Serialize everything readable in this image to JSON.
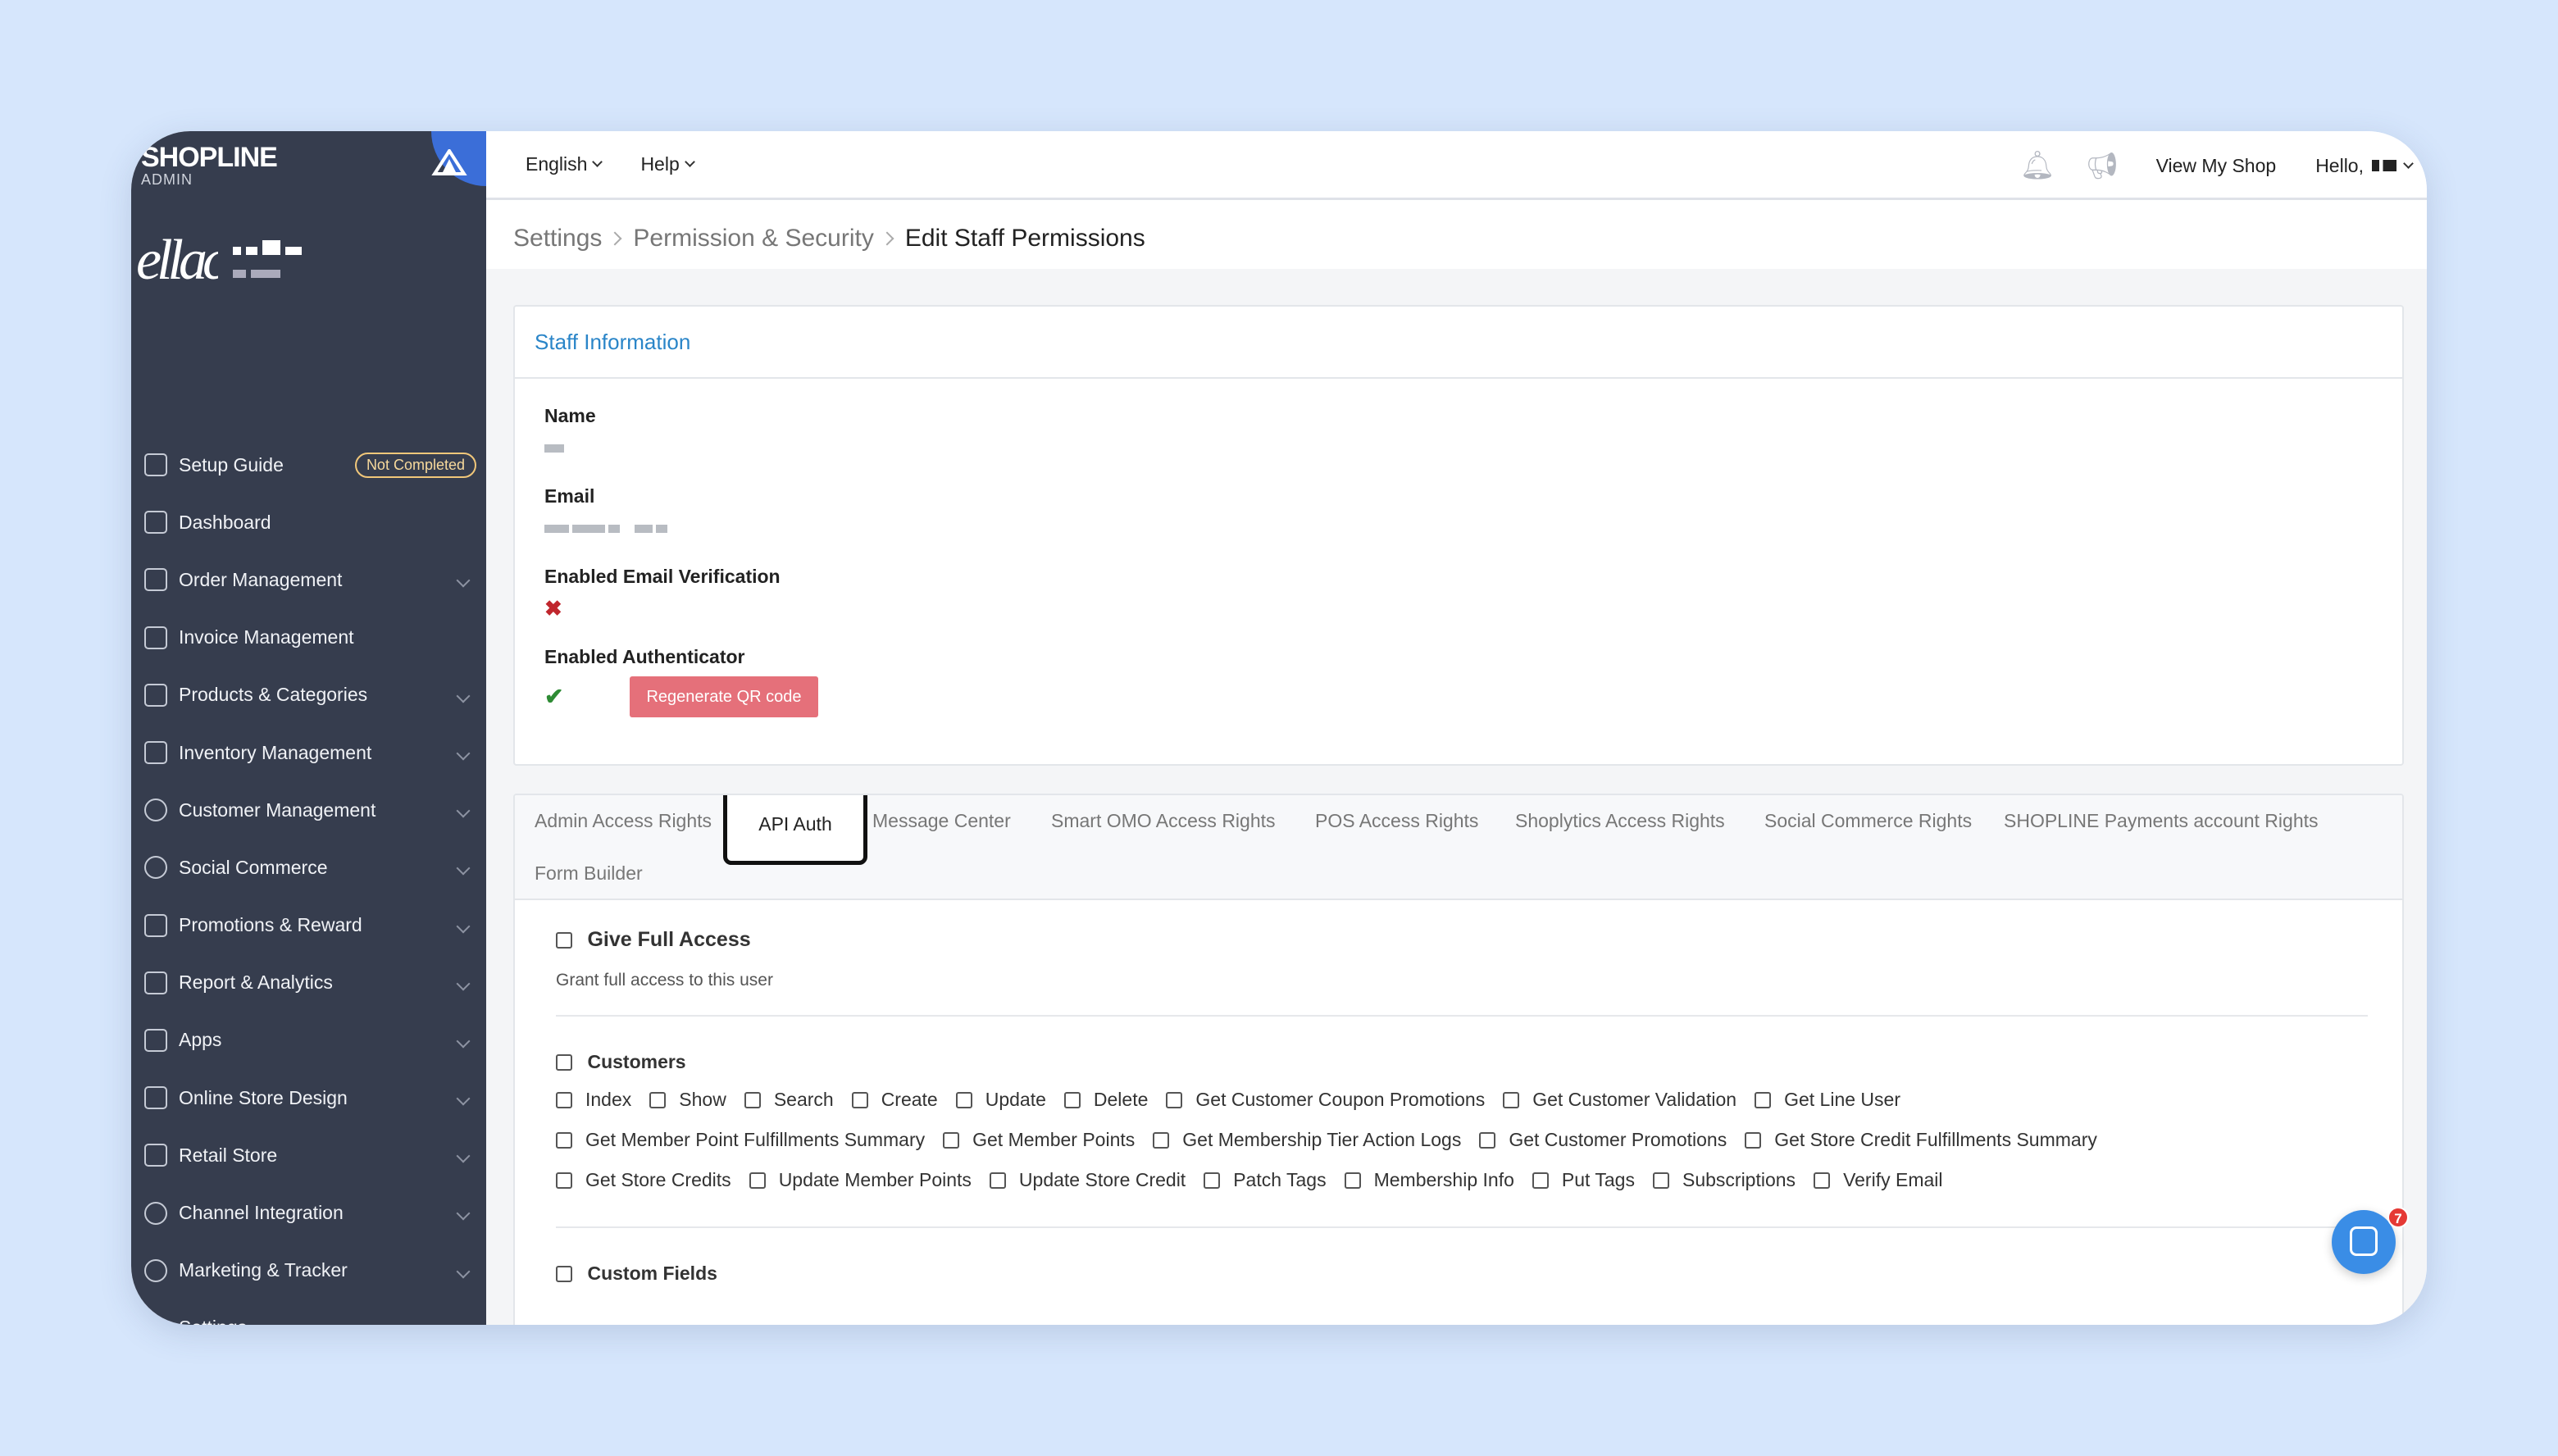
{
  "brand": {
    "logo": "SHOPLINE",
    "logo_sub": "ADMIN",
    "store_initials": "ellac"
  },
  "sidebar": {
    "setup_badge": "Not Completed",
    "items": [
      {
        "label": "Setup Guide",
        "icon": "signpost-icon"
      },
      {
        "label": "Dashboard",
        "icon": "dashboard-icon"
      },
      {
        "label": "Order Management",
        "icon": "order-icon"
      },
      {
        "label": "Invoice Management",
        "icon": "invoice-icon"
      },
      {
        "label": "Products & Categories",
        "icon": "bag-icon"
      },
      {
        "label": "Inventory Management",
        "icon": "inventory-icon"
      },
      {
        "label": "Customer Management",
        "icon": "user-icon"
      },
      {
        "label": "Social Commerce",
        "icon": "chat-icon"
      },
      {
        "label": "Promotions & Reward",
        "icon": "tag-icon"
      },
      {
        "label": "Report & Analytics",
        "icon": "chart-icon"
      },
      {
        "label": "Apps",
        "icon": "apps-icon"
      },
      {
        "label": "Online Store Design",
        "icon": "brush-icon"
      },
      {
        "label": "Retail Store",
        "icon": "store-icon"
      },
      {
        "label": "Channel Integration",
        "icon": "channel-icon"
      },
      {
        "label": "Marketing & Tracker",
        "icon": "target-icon"
      },
      {
        "label": "Settings",
        "icon": "gear-icon"
      }
    ]
  },
  "topbar": {
    "language": "English",
    "help": "Help",
    "view_shop": "View My Shop",
    "hello": "Hello,"
  },
  "breadcrumb": {
    "level1": "Settings",
    "level2": "Permission & Security",
    "current": "Edit Staff Permissions"
  },
  "staff": {
    "title": "Staff Information",
    "name_label": "Name",
    "email_label": "Email",
    "email_verif_label": "Enabled Email Verification",
    "auth_label": "Enabled Authenticator",
    "qr_button": "Regenerate QR code",
    "email_verified": false,
    "authenticator_enabled": true
  },
  "tabs": [
    "Admin Access Rights",
    "API Auth",
    "Message Center",
    "Smart OMO Access Rights",
    "POS Access Rights",
    "Shoplytics Access Rights",
    "Social Commerce Rights",
    "SHOPLINE Payments account Rights",
    "Form Builder"
  ],
  "active_tab": "API Auth",
  "permissions": {
    "full_access_title": "Give Full Access",
    "full_access_desc": "Grant full access to this user",
    "customers_title": "Customers",
    "customers_row1": [
      "Index",
      "Show",
      "Search",
      "Create",
      "Update",
      "Delete",
      "Get Customer Coupon Promotions",
      "Get Customer Validation",
      "Get Line User"
    ],
    "customers_row2": [
      "Get Member Point Fulfillments Summary",
      "Get Member Points",
      "Get Membership Tier Action Logs",
      "Get Customer Promotions",
      "Get Store Credit Fulfillments Summary"
    ],
    "customers_row3": [
      "Get Store Credits",
      "Update Member Points",
      "Update Store Credit",
      "Patch Tags",
      "Membership Info",
      "Put Tags",
      "Subscriptions",
      "Verify Email"
    ],
    "custom_fields_title": "Custom Fields"
  },
  "chat": {
    "badge": "7"
  },
  "colors": {
    "sidebar": "#363d4e",
    "accent": "#2a85c8",
    "qr_button": "#e5707a",
    "page_bg": "#d6e6fc"
  }
}
